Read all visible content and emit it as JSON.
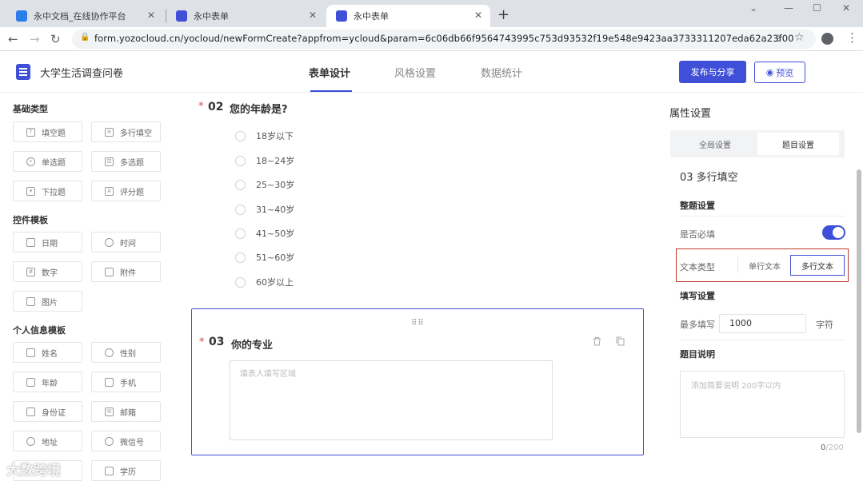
{
  "browser": {
    "tabs": [
      {
        "title": "永中文档_在线协作平台",
        "favicon_color": "#2b7de9"
      },
      {
        "title": "永中表单",
        "favicon_color": "#3f4fd8"
      },
      {
        "title": "永中表单",
        "favicon_color": "#3f4fd8"
      }
    ],
    "new_tab": "+",
    "url": "form.yozocloud.cn/yocloud/newFormCreate?appfrom=ycloud&param=6c06db66f9564743995c753d93532f19e548e9423aa3733311207eda62a23f00"
  },
  "header": {
    "title": "大学生活调查问卷",
    "tabs": [
      "表单设计",
      "风格设置",
      "数据统计"
    ],
    "active_tab": "表单设计",
    "publish_label": "发布与分享",
    "preview_label": "预览"
  },
  "sidebar": {
    "sections": [
      {
        "title": "基础类型",
        "items": [
          "填空题",
          "多行填空",
          "单选题",
          "多选题",
          "下拉题",
          "评分题"
        ]
      },
      {
        "title": "控件模板",
        "items": [
          "日期",
          "时间",
          "数字",
          "附件",
          "图片"
        ]
      },
      {
        "title": "个人信息模板",
        "items": [
          "姓名",
          "性别",
          "年龄",
          "手机",
          "身份证",
          "邮箱",
          "地址",
          "微信号",
          "",
          "学历"
        ]
      }
    ]
  },
  "form": {
    "q2": {
      "required": "*",
      "number": "02",
      "title": "您的年龄是?",
      "options": [
        "18岁以下",
        "18~24岁",
        "25~30岁",
        "31~40岁",
        "41~50岁",
        "51~60岁",
        "60岁以上"
      ]
    },
    "q3": {
      "required": "*",
      "number": "03",
      "title": "你的专业",
      "drag_handle": "⠿⠿",
      "placeholder": "填表人填写区域"
    }
  },
  "properties": {
    "title": "属性设置",
    "segments": [
      "全局设置",
      "题目设置"
    ],
    "active_segment": "题目设置",
    "question_label": "03  多行填空",
    "section_whole": "整题设置",
    "required_label": "是否必填",
    "required_on": true,
    "text_type_label": "文本类型",
    "text_type_options": [
      "单行文本",
      "多行文本"
    ],
    "text_type_selected": "多行文本",
    "section_fill": "填写设置",
    "max_label": "最多填写",
    "max_value": "1000",
    "max_unit": "字符",
    "section_desc": "题目说明",
    "desc_placeholder": "添加简要说明 200字以内",
    "counter_current": "0",
    "counter_max": "/200"
  },
  "watermark": "大数跨境",
  "colors": {
    "accent": "#3f4fd8",
    "highlight_box": "#c0392b",
    "required": "#e54545"
  }
}
